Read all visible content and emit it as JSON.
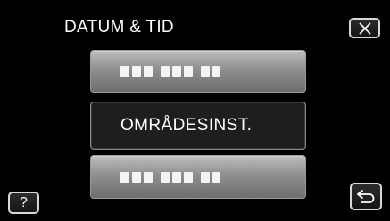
{
  "header": {
    "title": "DATUM & TID"
  },
  "menu": {
    "items": [
      {
        "label": "",
        "state": "dimmed-obscured"
      },
      {
        "label": "OMRÅDESINST.",
        "state": "highlighted"
      },
      {
        "label": "",
        "state": "dimmed-obscured"
      }
    ]
  },
  "buttons": {
    "close_icon": "close-icon",
    "help_label": "?",
    "back_icon": "return-arrow-icon"
  },
  "colors": {
    "background": "#000000",
    "button_gray": "#9a9a9a",
    "selected_button": "#1e1e1e",
    "text": "#ffffff"
  }
}
